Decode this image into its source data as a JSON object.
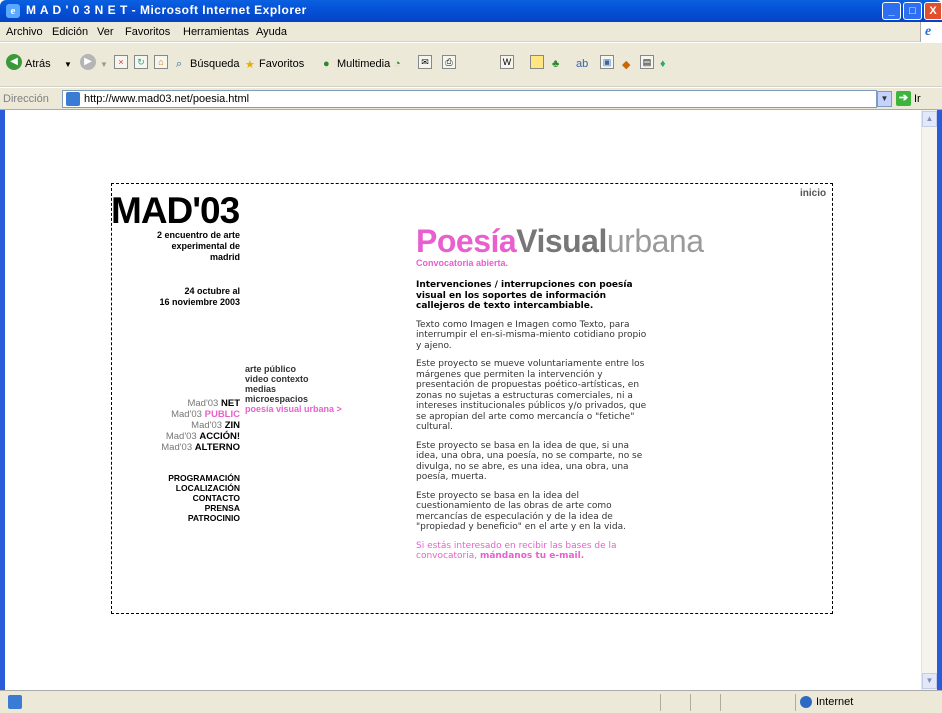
{
  "window": {
    "title": "M A D ' 0 3 N E T - Microsoft Internet Explorer",
    "min": "_",
    "max": "□",
    "close": "X"
  },
  "menubar": [
    "Archivo",
    "Edición",
    "Ver",
    "Favoritos",
    "Herramientas",
    "Ayuda"
  ],
  "toolbar": {
    "back": "Atrás",
    "search": "Búsqueda",
    "favorites": "Favoritos",
    "media": "Multimedia"
  },
  "address": {
    "label": "Dirección",
    "url": "http://www.mad03.net/poesia.html",
    "go": "Ir"
  },
  "status": {
    "zone": "Internet"
  },
  "page": {
    "inicio": "inicio",
    "logo": "MAD'03",
    "subtitle1": [
      "2 encuentro de arte",
      "experimental de",
      "madrid"
    ],
    "subtitle2": [
      "24 octubre al",
      "16 noviembre 2003"
    ],
    "sections": [
      "arte público",
      "video contexto",
      "medias",
      "microespacios",
      "poesía visual urbana >"
    ],
    "mad_items": [
      {
        "pre": "Mad'03 ",
        "post": "NET"
      },
      {
        "pre": "Mad'03 ",
        "post": "PUBLIC"
      },
      {
        "pre": "Mad'03 ",
        "post": "ZIN"
      },
      {
        "pre": "Mad'03 ",
        "post": "ACCIÓN!"
      },
      {
        "pre": "Mad'03 ",
        "post": "ALTERNO"
      }
    ],
    "menu": [
      "PROGRAMACIÓN",
      "LOCALIZACIÓN",
      "CONTACTO",
      "PRENSA",
      "PATROCINIO"
    ],
    "title_poesia": "Poesía",
    "title_visual": "Visual",
    "title_urbana": "urbana",
    "convocatoria": "Convocatoria abierta.",
    "lead": "Intervenciones / interrupciones con poesía visual en los soportes de información callejeros de texto intercambiable.",
    "p1": "Texto como Imagen e Imagen como Texto, para interrumpir el en-si-misma-miento cotidiano propio y ajeno.",
    "p2": "Este proyecto se mueve voluntariamente entre los márgenes que permiten la intervención y presentación de propuestas poético-artísticas, en zonas no sujetas a estructuras comerciales, ni a intereses institucionales públicos y/o privados, que se apropian del arte como mercancía o \"fetiche\" cultural.",
    "p3": "Este proyecto se basa en la idea de que, si una idea, una obra, una poesía, no se comparte, no se divulga, no se abre, es una idea, una obra, una poesía, muerta.",
    "p4": "Este proyecto se basa en la idea del cuestionamiento de las obras de arte como mercancías de especulación y de la idea de \"propiedad y beneficio\" en el arte y en la vida.",
    "p5_text": "Si estás interesado en recibir las bases de la convocatoria, ",
    "p5_link": "mándanos tu e-mail."
  },
  "colors": {
    "accent_pink": "#e95fcf",
    "xp_blue": "#0552d8"
  }
}
